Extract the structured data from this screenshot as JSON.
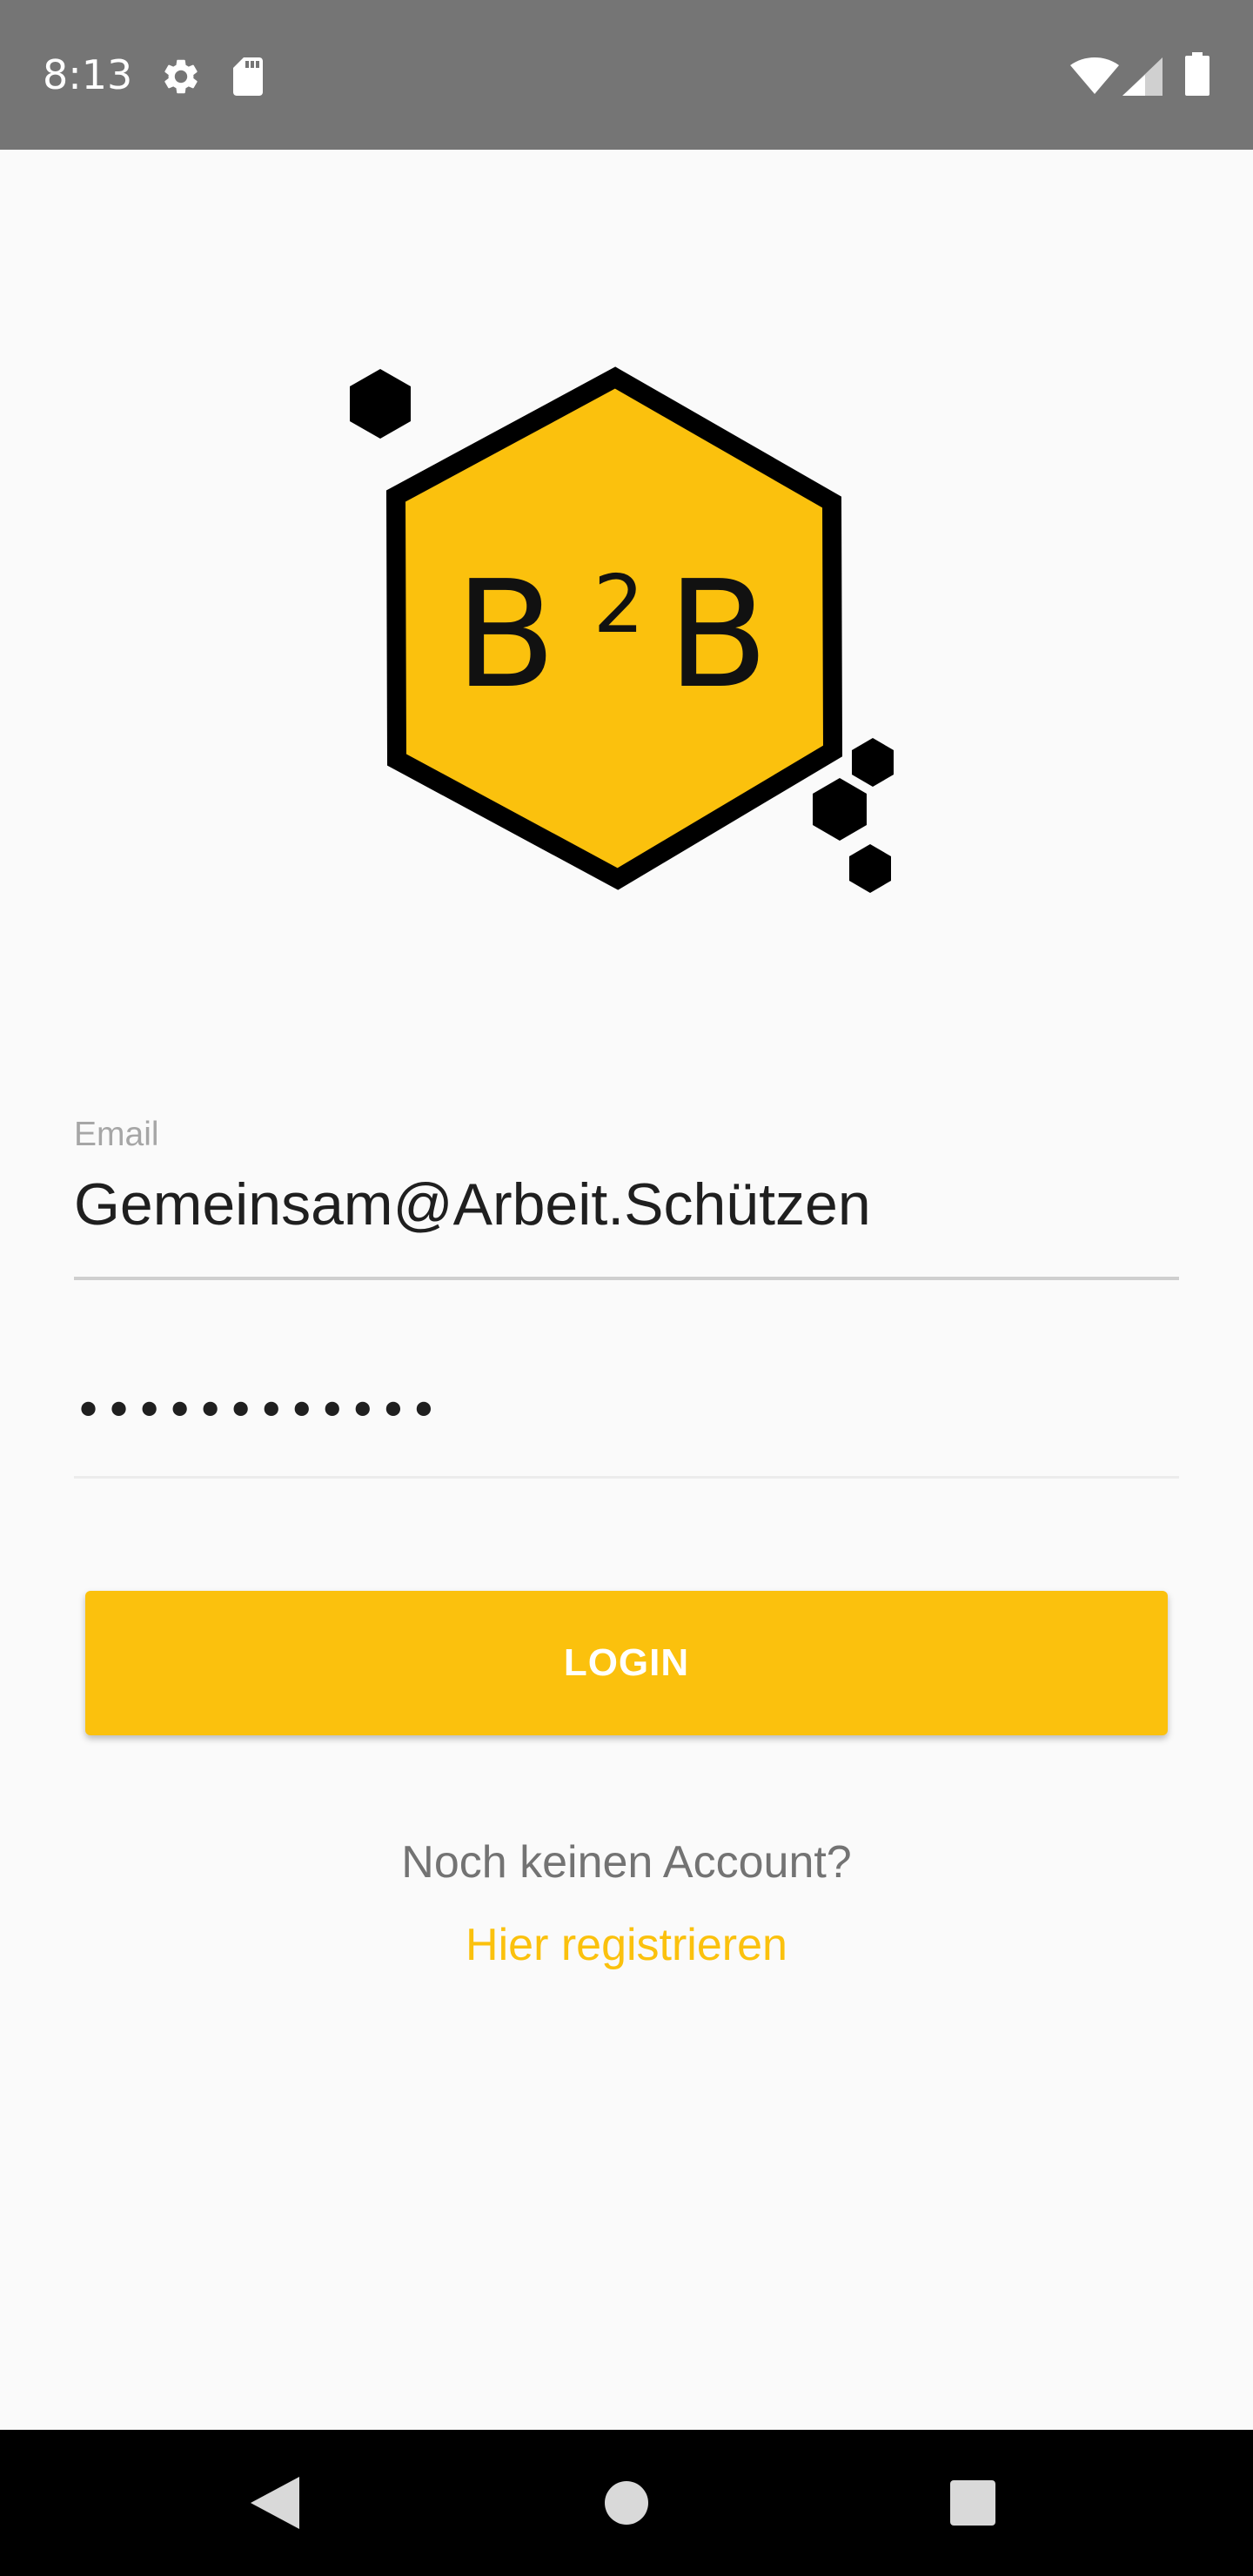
{
  "status_bar": {
    "time": "8:13",
    "icons": [
      "settings-icon",
      "sd-card-icon",
      "wifi-icon",
      "cellular-signal-icon",
      "battery-icon"
    ],
    "background_color": "#757575"
  },
  "logo": {
    "letter_left": "B",
    "superscript": "2",
    "letter_right": "B",
    "fill_color": "#fbc10d",
    "outline_color": "#000000"
  },
  "form": {
    "email_label": "Email",
    "email_value": "Gemeinsam@Arbeit.Schützen",
    "password_value": "••••••••••••"
  },
  "login_button": {
    "label": "LOGIN",
    "color": "#fbc10d"
  },
  "register": {
    "prompt": "Noch keinen Account?",
    "link_label": "Hier registrieren",
    "link_color": "#fbc10d"
  },
  "nav_bar": {
    "buttons": [
      "back-icon",
      "home-icon",
      "recents-icon"
    ]
  }
}
